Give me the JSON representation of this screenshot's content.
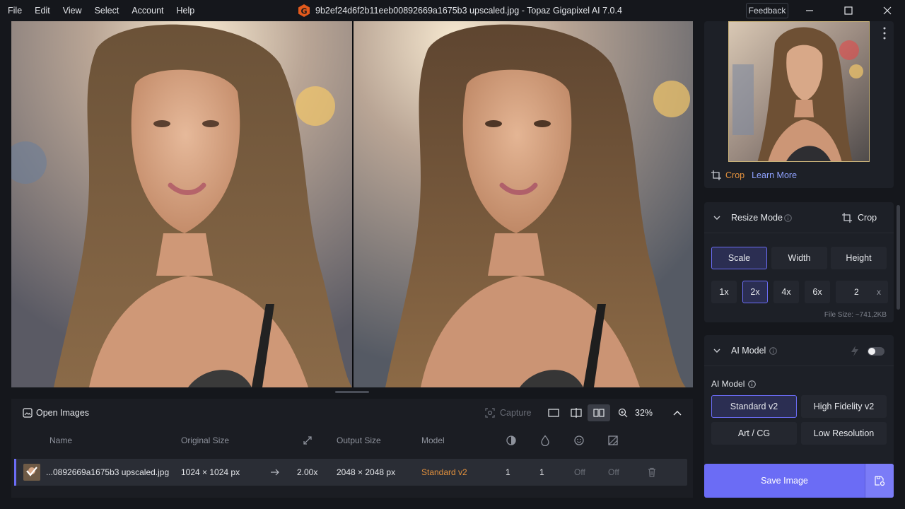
{
  "menu": [
    "File",
    "Edit",
    "View",
    "Select",
    "Account",
    "Help"
  ],
  "window": {
    "title": "9b2ef24d6f2b11eeb00892669a1675b3 upscaled.jpg - Topaz Gigapixel AI 7.0.4",
    "feedback_label": "Feedback",
    "logo_letter": "G"
  },
  "toolbar": {
    "open_images_label": "Open Images",
    "capture_label": "Capture",
    "zoom_label": "32%"
  },
  "table": {
    "headers": {
      "name": "Name",
      "original_size": "Original Size",
      "output_size": "Output Size",
      "model": "Model"
    },
    "rows": [
      {
        "name": "...0892669a1675b3 upscaled.jpg",
        "original_size": "1024 × 1024 px",
        "scale": "2.00x",
        "output_size": "2048 × 2048 px",
        "model": "Standard v2",
        "col1": "1",
        "col2": "1",
        "col3": "Off",
        "col4": "Off"
      }
    ]
  },
  "side": {
    "crop_label": "Crop",
    "learn_more_label": "Learn More",
    "resize": {
      "title": "Resize Mode",
      "crop_button": "Crop",
      "modes": [
        "Scale",
        "Width",
        "Height"
      ],
      "selected_mode": "Scale",
      "scales": [
        "1x",
        "2x",
        "4x",
        "6x"
      ],
      "selected_scale": "2x",
      "custom_value": "2",
      "custom_unit": "x",
      "file_size": "File Size: ~741,2KB"
    },
    "ai_model": {
      "title": "AI Model",
      "label": "AI Model",
      "models": [
        "Standard v2",
        "High Fidelity v2",
        "Art / CG",
        "Low Resolution"
      ],
      "selected_model": "Standard v2"
    }
  },
  "save": {
    "label": "Save Image"
  },
  "colors": {
    "accent": "#6b6cf5",
    "model_orange": "#e3913d",
    "link_blue": "#8fa2ff"
  }
}
